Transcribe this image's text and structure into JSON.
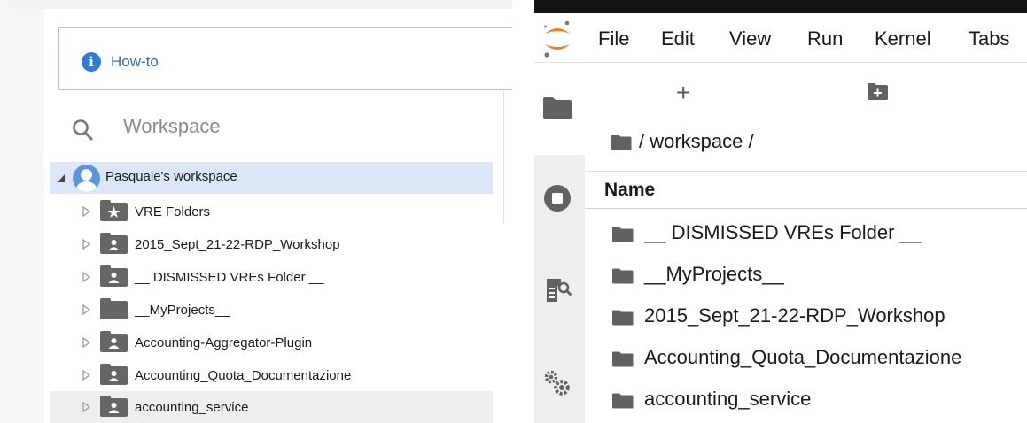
{
  "left_panel": {
    "howto_label": "How-to",
    "search_label": "Workspace",
    "root": {
      "label": "Pasquale's workspace"
    },
    "items": [
      {
        "label": "VRE Folders",
        "icon": "star-folder-icon"
      },
      {
        "label": "2015_Sept_21-22-RDP_Workshop",
        "icon": "shared-folder-icon"
      },
      {
        "label": "__ DISMISSED VREs Folder __",
        "icon": "shared-folder-icon"
      },
      {
        "label": "__MyProjects__",
        "icon": "folder-icon"
      },
      {
        "label": "Accounting-Aggregator-Plugin",
        "icon": "shared-folder-icon"
      },
      {
        "label": "Accounting_Quota_Documentazione",
        "icon": "shared-folder-icon"
      },
      {
        "label": "accounting_service",
        "icon": "shared-folder-icon"
      }
    ]
  },
  "right_panel": {
    "menu": [
      "File",
      "Edit",
      "View",
      "Run",
      "Kernel",
      "Tabs"
    ],
    "toolbar": {
      "new_launcher": "+"
    },
    "breadcrumb": "/ workspace /",
    "column_header": "Name",
    "files": [
      "__ DISMISSED VREs Folder __",
      "__MyProjects__",
      "2015_Sept_21-22-RDP_Workshop",
      "Accounting_Quota_Documentazione",
      "accounting_service"
    ]
  },
  "colors": {
    "howto_accent": "#2f7ad6",
    "selected_row": "#dde6f6",
    "jupyter_orange": "#f37726",
    "folder_gray": "#616161"
  }
}
